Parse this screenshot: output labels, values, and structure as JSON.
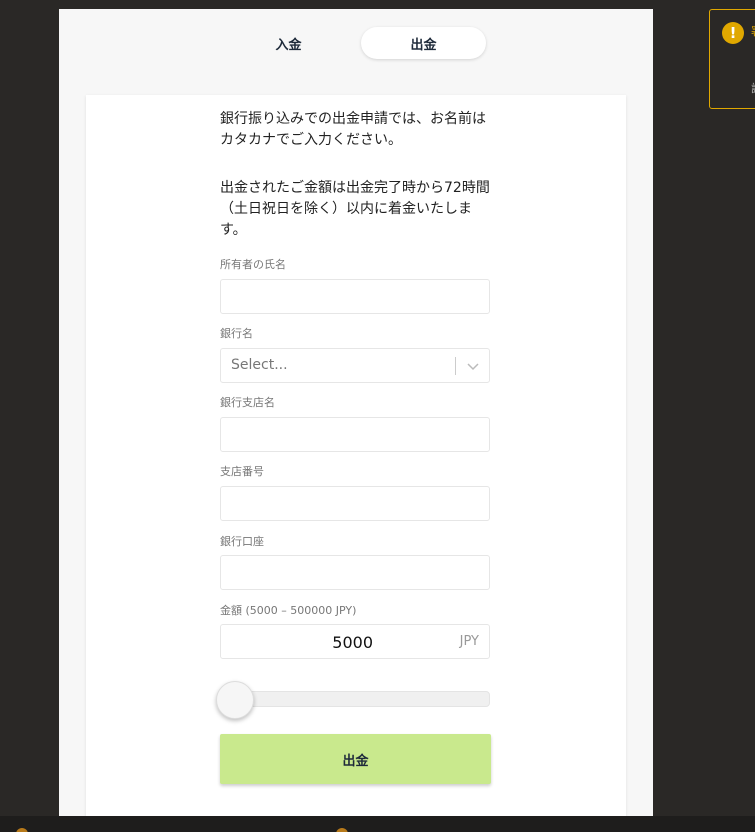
{
  "tabs": {
    "deposit": "入金",
    "withdraw": "出金"
  },
  "info": {
    "line1": "銀行振り込みでの出金申請では、お名前はカタカナでご入力ください。",
    "line2": "出金されたご金額は出金完了時から72時間（土日祝日を除く）以内に着金いたします。"
  },
  "form": {
    "owner_label": "所有者の氏名",
    "owner_value": "",
    "bank_label": "銀行名",
    "bank_placeholder": "Select...",
    "branch_label": "銀行支店名",
    "branch_value": "",
    "branch_no_label": "支店番号",
    "branch_no_value": "",
    "account_label": "銀行口座",
    "account_value": "",
    "amount_label": "金額 (5000 – 500000 JPY)",
    "amount_value": "5000",
    "amount_unit": "JPY",
    "slider_min": 5000,
    "slider_max": 500000,
    "slider_value": 5000,
    "submit_label": "出金"
  },
  "notice": {
    "text1": "署",
    "text2": "詞"
  },
  "colors": {
    "accent": "#c9e98d",
    "warning": "#e0a800",
    "background": "#2a2826"
  }
}
